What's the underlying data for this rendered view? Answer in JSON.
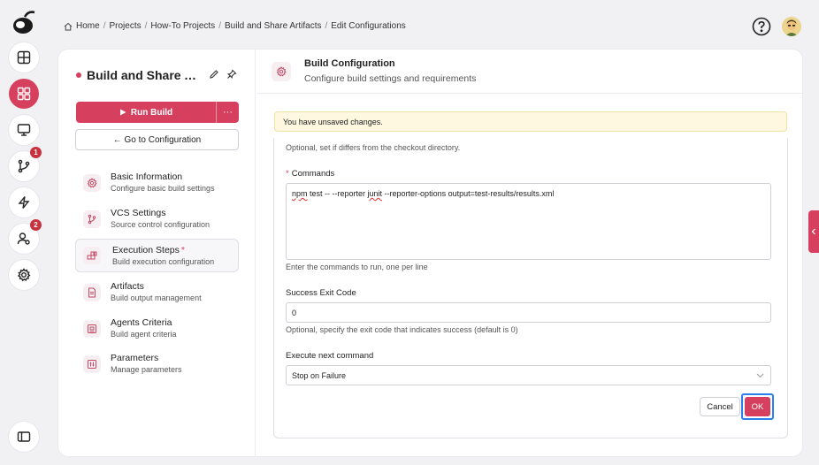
{
  "breadcrumb": [
    "Home",
    "Projects",
    "How-To Projects",
    "Build and Share Artifacts",
    "Edit Configurations"
  ],
  "rail": {
    "badges": {
      "vcs": "1",
      "users": "2"
    }
  },
  "project": {
    "title": "Build and Share Artifacts"
  },
  "actions": {
    "run_build": "Run Build",
    "more": "···",
    "goto_config": "← Go to Configuration"
  },
  "nav": [
    {
      "title": "Basic Information",
      "subtitle": "Configure basic build settings",
      "icon": "gear-icon"
    },
    {
      "title": "VCS Settings",
      "subtitle": "Source control configuration",
      "icon": "branch-icon"
    },
    {
      "title": "Execution Steps",
      "subtitle": "Build execution configuration",
      "icon": "steps-icon",
      "required": "*"
    },
    {
      "title": "Artifacts",
      "subtitle": "Build output management",
      "icon": "file-icon"
    },
    {
      "title": "Agents Criteria",
      "subtitle": "Build agent criteria",
      "icon": "agent-icon"
    },
    {
      "title": "Parameters",
      "subtitle": "Manage parameters",
      "icon": "params-icon"
    }
  ],
  "header": {
    "title": "Build Configuration",
    "subtitle": "Configure build settings and requirements"
  },
  "notice": "You have unsaved changes.",
  "form": {
    "checkout_help": "Optional, set if differs from the checkout directory.",
    "commands_label": "Commands",
    "commands_required": "*",
    "commands_value_a": "npm",
    "commands_value_b": " test -- --reporter ",
    "commands_value_c": "junit",
    "commands_value_d": " --reporter-options output=test-results/results.xml",
    "commands_help": "Enter the commands to run, one per line",
    "exit_code_label": "Success Exit Code",
    "exit_code_value": "0",
    "exit_code_help": "Optional, specify the exit code that indicates success (default is 0)",
    "next_label": "Execute next command",
    "next_value": "Stop on Failure",
    "cancel": "Cancel",
    "ok": "OK"
  },
  "colors": {
    "accent": "#d6405e",
    "focus": "#2a7ff0"
  }
}
